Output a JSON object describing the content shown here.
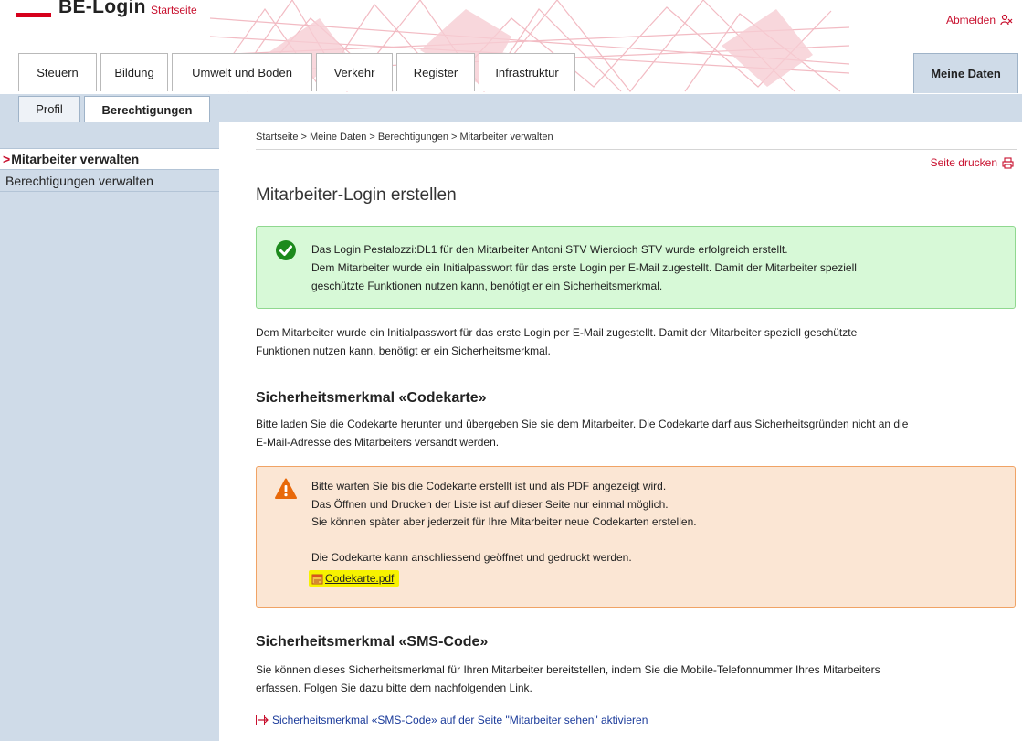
{
  "header": {
    "app_title": "BE-Login",
    "home_link": "Startseite",
    "logout_label": "Abmelden"
  },
  "main_tabs": [
    {
      "label": "Steuern"
    },
    {
      "label": "Bildung"
    },
    {
      "label": "Umwelt und Boden"
    },
    {
      "label": "Verkehr"
    },
    {
      "label": "Register"
    },
    {
      "label": "Infrastruktur"
    },
    {
      "label": "Meine Daten",
      "active": true
    }
  ],
  "sub_tabs": [
    {
      "label": "Profil"
    },
    {
      "label": "Berechtigungen",
      "active": true
    }
  ],
  "sidebar": {
    "active_marker": ">",
    "items": [
      {
        "label": "Mitarbeiter verwalten",
        "active": true
      },
      {
        "label": "Berechtigungen verwalten"
      }
    ]
  },
  "breadcrumb": "Startseite > Meine Daten > Berechtigungen > Mitarbeiter verwalten",
  "print_label": "Seite drucken",
  "page_title": "Mitarbeiter-Login erstellen",
  "success": {
    "line1": "Das Login Pestalozzi:DL1 für den Mitarbeiter Antoni STV Wiercioch STV wurde erfolgreich erstellt.",
    "line2": "Dem Mitarbeiter wurde ein Initialpasswort für das erste Login per E-Mail zugestellt. Damit der Mitarbeiter speziell",
    "line3": "geschützte Funktionen nutzen kann, benötigt er ein Sicherheitsmerkmal."
  },
  "intro": {
    "line1": "Dem Mitarbeiter wurde ein Initialpasswort für das erste Login per E-Mail zugestellt. Damit der Mitarbeiter speziell geschützte",
    "line2": "Funktionen nutzen kann, benötigt er ein Sicherheitsmerkmal."
  },
  "codekarte": {
    "heading": "Sicherheitsmerkmal «Codekarte»",
    "text1": "Bitte laden Sie die Codekarte herunter und übergeben Sie sie dem Mitarbeiter. Die Codekarte darf aus Sicherheitsgründen nicht an die",
    "text2": "E-Mail-Adresse des Mitarbeiters versandt werden.",
    "warning": {
      "line1": "Bitte warten Sie bis die Codekarte erstellt ist und als PDF angezeigt wird.",
      "line2": "Das Öffnen und Drucken der Liste ist auf dieser Seite nur einmal möglich.",
      "line3": "Sie können später aber jederzeit für Ihre Mitarbeiter neue Codekarten erstellen.",
      "line4": "Die Codekarte kann anschliessend geöffnet und gedruckt werden."
    },
    "pdf_link": "Codekarte.pdf"
  },
  "sms": {
    "heading": "Sicherheitsmerkmal «SMS-Code»",
    "text1": "Sie können dieses Sicherheitsmerkmal für Ihren Mitarbeiter bereitstellen, indem Sie die Mobile-Telefonnummer Ihres Mitarbeiters",
    "text2": "erfassen. Folgen Sie dazu bitte dem nachfolgenden Link.",
    "link": "Sicherheitsmerkmal «SMS-Code» auf der Seite \"Mitarbeiter sehen\" aktivieren"
  },
  "colors": {
    "brand_red": "#c8102e",
    "nav_blue": "#cfdbe8",
    "success_bg": "#d7f9d7",
    "warning_bg": "#fbe6d4",
    "highlight": "#f7f200"
  }
}
